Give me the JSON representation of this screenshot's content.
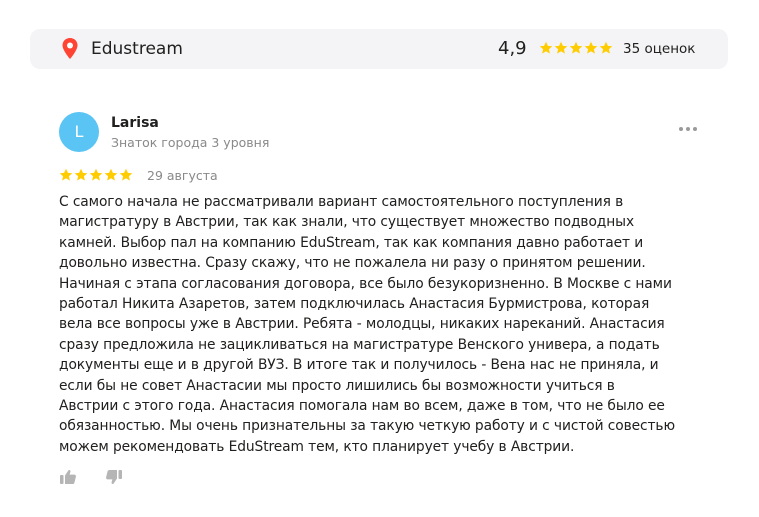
{
  "organization": {
    "name": "Edustream",
    "rating": "4,9",
    "stars": 5,
    "review_count": "35 оценок"
  },
  "review": {
    "author_initial": "L",
    "author_name": "Larisa",
    "author_level": "Знаток города 3 уровня",
    "stars": 5,
    "date": "29 августа",
    "text_lines": [
      "С самого начала не рассматривали вариант самостоятельного поступления в",
      "магистратуру в Австрии, так как знали, что существует множество подводных",
      "камней. Выбор пал на компанию EduStream, так как компания давно работает и",
      "довольно известна. Сразу скажу, что не пожалела ни разу о принятом решении.",
      "Начиная с этапа согласования договора, все было безукоризненно. В Москве с нами",
      "работал Никита Азаретов, затем подключилась Анастасия Бурмистрова, которая",
      "вела все вопросы уже в Австрии. Ребята - молодцы, никаких нареканий. Анастасия",
      "сразу предложила не зацикливаться на магистратуре Венского универа, а подать",
      "документы еще и в другой ВУЗ. В итоге так и получилось - Вена нас не приняла, и",
      "если бы не совет Анастасии мы просто лишились бы возможности учиться в",
      "Австрии с этого года. Анастасия помогала нам во всем, даже в том, что не было ее",
      "обязанностью. Мы очень признательны за такую четкую работу и с чистой совестью",
      "можем рекомендовать EduStream тем, кто планирует учебу в Австрии."
    ]
  },
  "colors": {
    "star": "#fc0",
    "pin": "#f43",
    "avatar": "#5ac4f4",
    "muted_text": "#898989",
    "topbar_bg": "#f4f4f6"
  },
  "icons": {
    "pin": "location-pin-icon",
    "star": "star-icon",
    "more": "more-dots-icon",
    "like": "thumbs-up-icon",
    "dislike": "thumbs-down-icon"
  }
}
